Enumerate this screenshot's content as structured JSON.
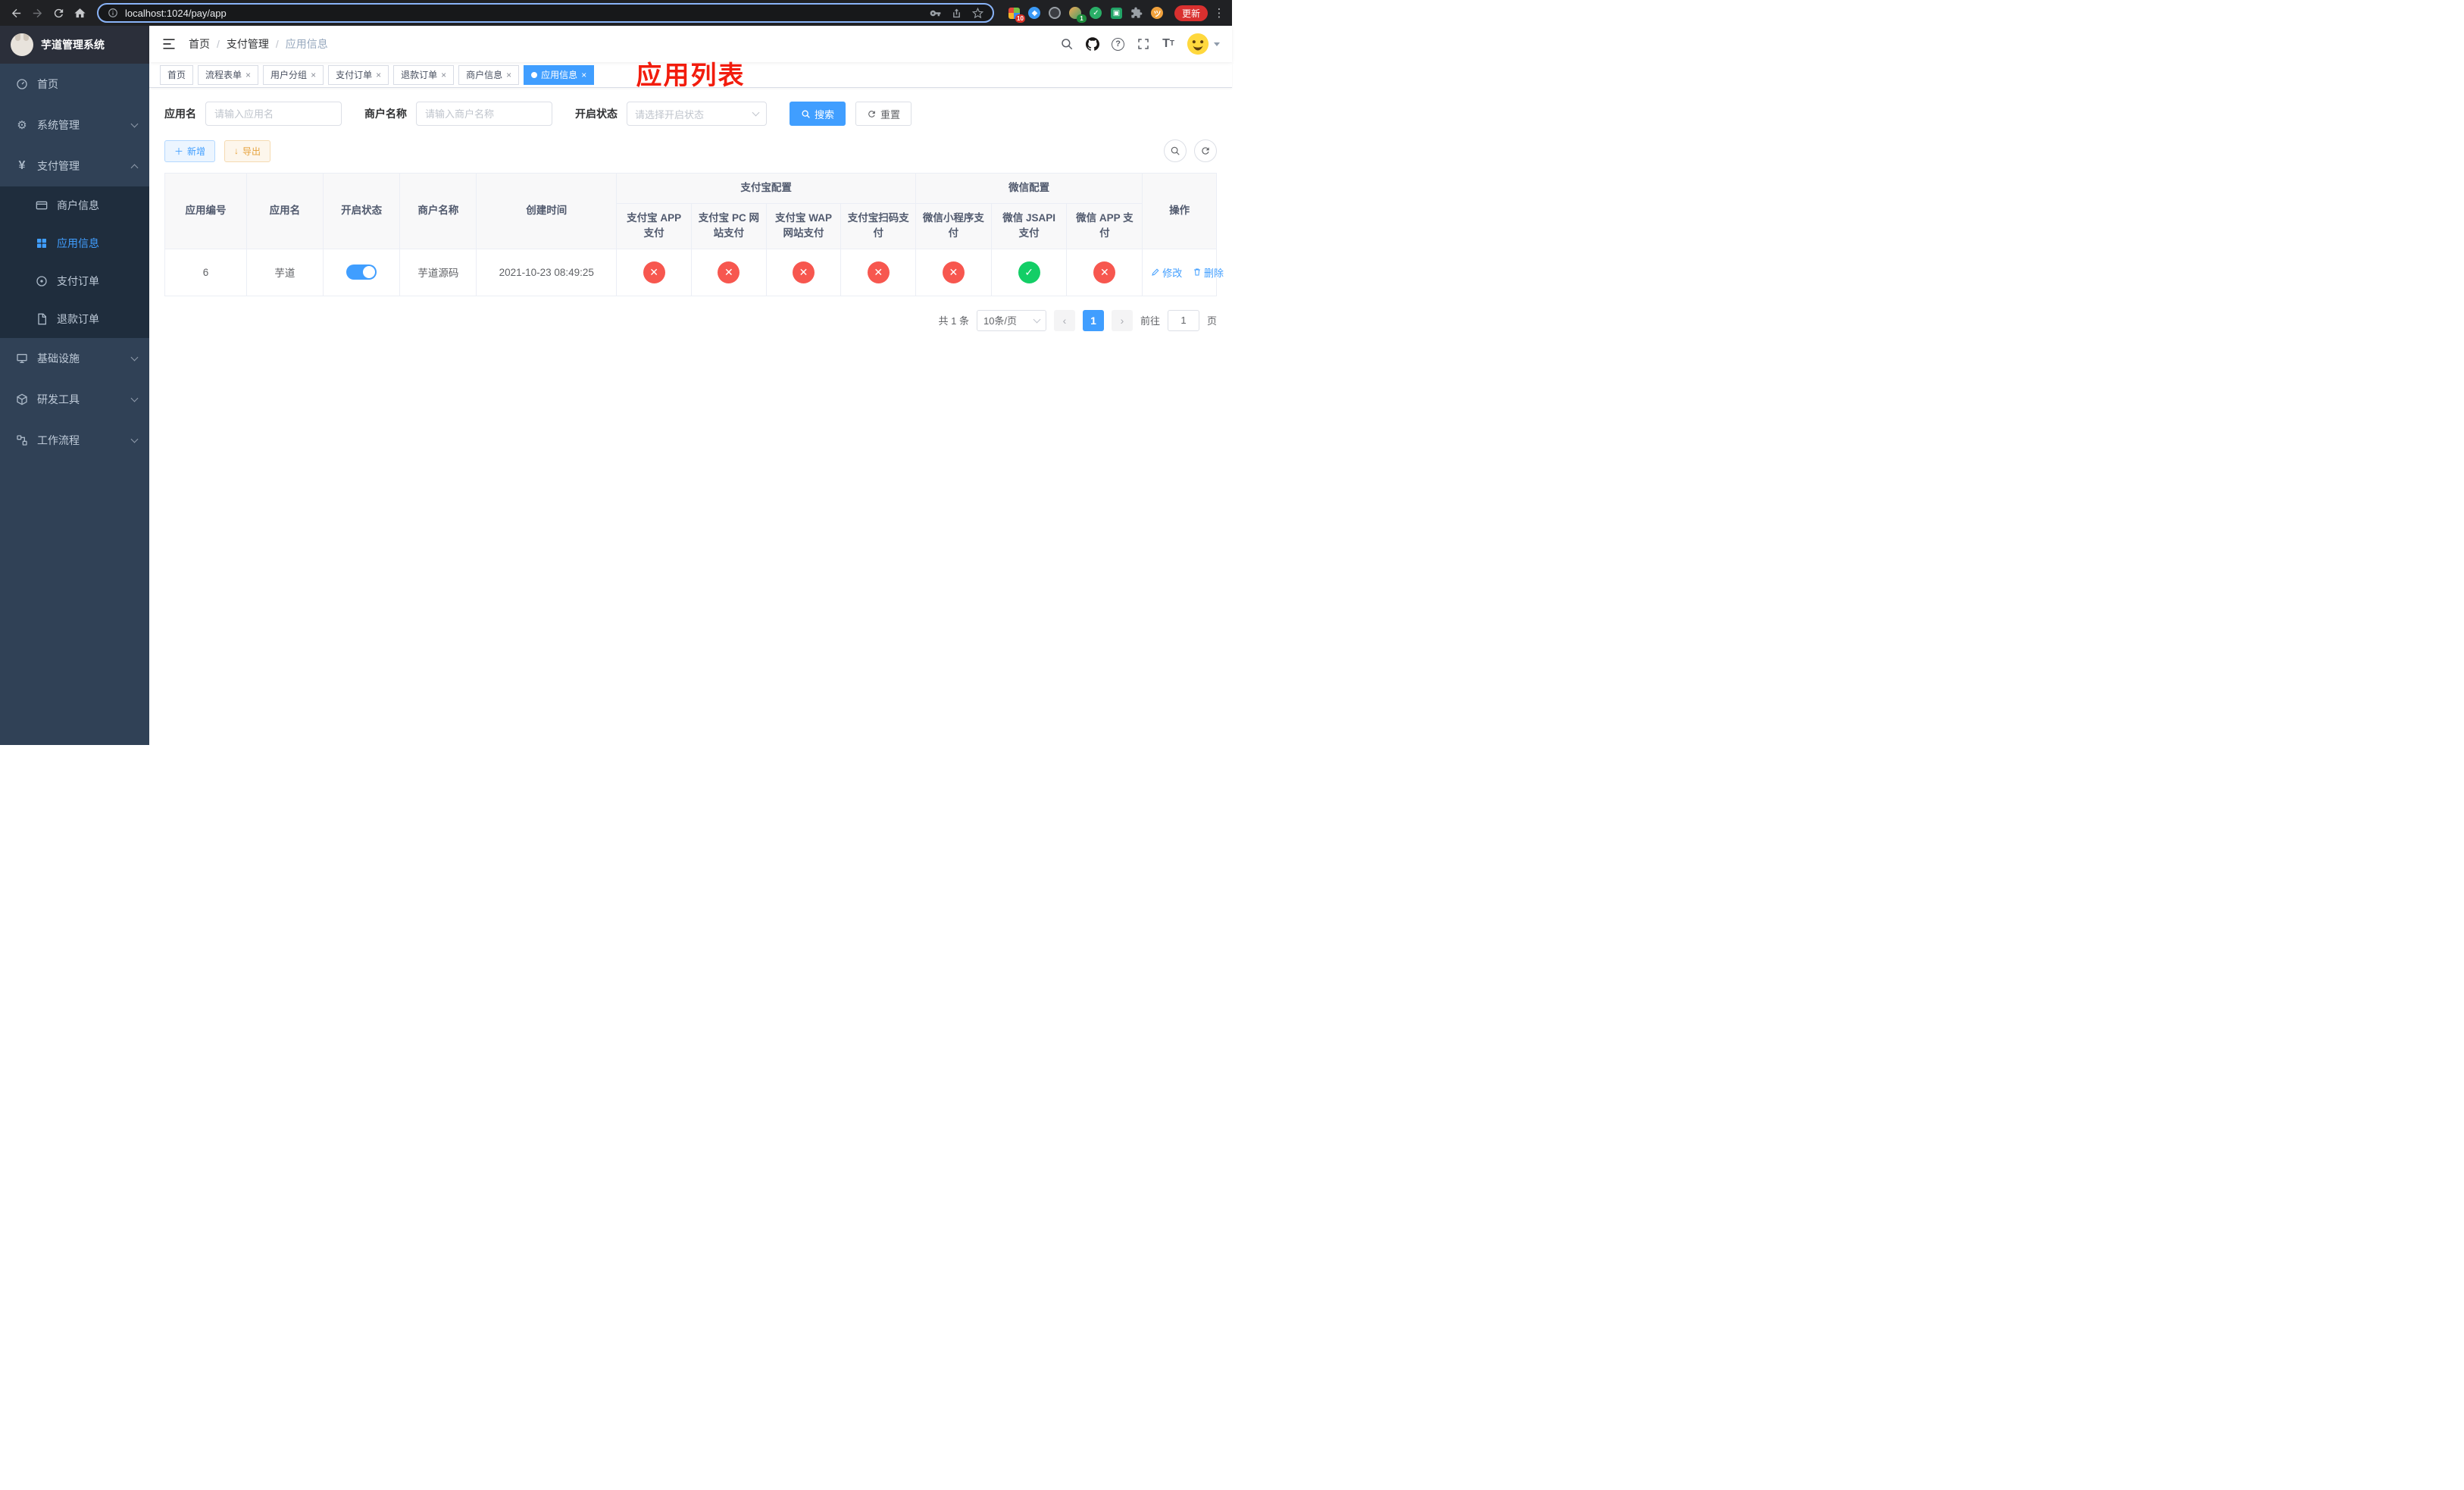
{
  "colors": {
    "primary": "#409eff",
    "danger": "#f7574f",
    "success": "#13ce66",
    "annotation_red": "#f21c0d",
    "sidebar_bg": "#304156",
    "sidebar_sub_bg": "#1f2d3d"
  },
  "browser": {
    "url": "localhost:1024/pay/app",
    "update_label": "更新",
    "ext_badge_1": "10",
    "ext_badge_2": "1"
  },
  "sidebar": {
    "title": "芋道管理系统",
    "items": [
      {
        "label": "首页"
      },
      {
        "label": "系统管理"
      },
      {
        "label": "支付管理",
        "children": [
          {
            "label": "商户信息"
          },
          {
            "label": "应用信息"
          },
          {
            "label": "支付订单"
          },
          {
            "label": "退款订单"
          }
        ]
      },
      {
        "label": "基础设施"
      },
      {
        "label": "研发工具"
      },
      {
        "label": "工作流程"
      }
    ]
  },
  "breadcrumb": [
    "首页",
    "支付管理",
    "应用信息"
  ],
  "annotation": "应用列表",
  "tabs": [
    {
      "label": "首页"
    },
    {
      "label": "流程表单"
    },
    {
      "label": "用户分组"
    },
    {
      "label": "支付订单"
    },
    {
      "label": "退款订单"
    },
    {
      "label": "商户信息"
    },
    {
      "label": "应用信息"
    }
  ],
  "filters": {
    "app_name_label": "应用名",
    "app_name_placeholder": "请输入应用名",
    "merchant_label": "商户名称",
    "merchant_placeholder": "请输入商户名称",
    "status_label": "开启状态",
    "status_placeholder": "请选择开启状态",
    "search_label": "搜索",
    "reset_label": "重置"
  },
  "toolbar": {
    "add_label": "新增",
    "export_label": "导出"
  },
  "table": {
    "columns": {
      "id": "应用编号",
      "name": "应用名",
      "status": "开启状态",
      "merchant": "商户名称",
      "created": "创建时间",
      "ops": "操作"
    },
    "groups": {
      "alipay": "支付宝配置",
      "wechat": "微信配置"
    },
    "alipay_columns": [
      "支付宝 APP 支付",
      "支付宝 PC 网站支付",
      "支付宝 WAP 网站支付",
      "支付宝扫码支付"
    ],
    "wechat_columns": [
      "微信小程序支付",
      "微信 JSAPI 支付",
      "微信 APP 支付"
    ],
    "rows": [
      {
        "id": "6",
        "name": "芋道",
        "enabled": true,
        "merchant": "芋道源码",
        "created": "2021-10-23 08:49:25",
        "alipay_app": false,
        "alipay_pc": false,
        "alipay_wap": false,
        "alipay_qr": false,
        "wechat_mini": false,
        "wechat_jsapi": true,
        "wechat_app": false,
        "edit_label": "修改",
        "delete_label": "删除"
      }
    ]
  },
  "pagination": {
    "total": "共 1 条",
    "page_size": "10条/页",
    "page": "1",
    "goto_label": "前往",
    "goto_value": "1",
    "unit_label": "页"
  }
}
